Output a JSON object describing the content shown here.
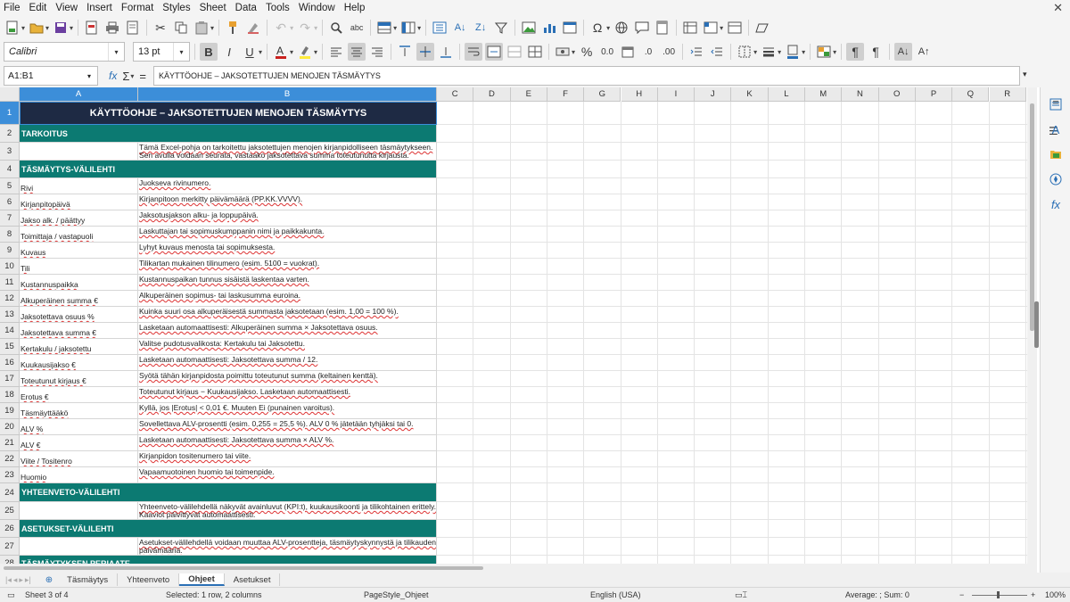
{
  "menu": {
    "items": [
      "File",
      "Edit",
      "View",
      "Insert",
      "Format",
      "Styles",
      "Sheet",
      "Data",
      "Tools",
      "Window",
      "Help"
    ],
    "close": "✕"
  },
  "format_bar": {
    "font_name": "Calibri",
    "font_size": "13 pt",
    "bold": "B",
    "italic": "I",
    "underline": "U"
  },
  "formula_bar": {
    "name_box": "A1:B1",
    "fx": "fx",
    "sigma": "Σ",
    "equals": "=",
    "content": "KÄYTTÖOHJE – JAKSOTETTUJEN MENOJEN TÄSMÄYTYS"
  },
  "columns": [
    "A",
    "B",
    "C",
    "D",
    "E",
    "F",
    "G",
    "H",
    "I",
    "J",
    "K",
    "L",
    "M",
    "N",
    "O",
    "P",
    "Q",
    "R"
  ],
  "rows": [
    {
      "num": "1",
      "type": "title",
      "text": "KÄYTTÖOHJE – JAKSOTETTUJEN MENOJEN TÄSMÄYTYS"
    },
    {
      "num": "2",
      "type": "section",
      "text": "TARKOITUS"
    },
    {
      "num": "3",
      "type": "row",
      "a": "",
      "b": "Tämä Excel-pohja on tarkoitettu jaksotettujen menojen kirjanpidolliseen täsmäytykseen. Sen avulla voidaan seurata, vastaako jaksotettava summa toteutunutta kirjausta."
    },
    {
      "num": "4",
      "type": "section",
      "text": "TÄSMÄYTYS-VÄLILEHTI"
    },
    {
      "num": "5",
      "type": "row",
      "a": "Rivi",
      "b": "Juokseva rivinumero."
    },
    {
      "num": "6",
      "type": "row",
      "a": "Kirjanpitopäivä",
      "b": "Kirjanpitoon merkitty päivämäärä (PP.KK.VVVV)."
    },
    {
      "num": "7",
      "type": "row",
      "a": "Jakso alk. / päättyy",
      "b": "Jaksotusjakson alku- ja loppupäivä."
    },
    {
      "num": "8",
      "type": "row",
      "a": "Toimittaja / vastapuoli",
      "b": "Laskuttajan tai sopimuskumppanin nimi ja paikkakunta."
    },
    {
      "num": "9",
      "type": "row",
      "a": "Kuvaus",
      "b": "Lyhyt kuvaus menosta tai sopimuksesta."
    },
    {
      "num": "10",
      "type": "row",
      "a": "Tili",
      "b": "Tilikartan mukainen tilinumero (esim. 5100 = vuokrat)."
    },
    {
      "num": "11",
      "type": "row",
      "a": "Kustannuspaikka",
      "b": "Kustannuspaikan tunnus sisäistä laskentaa varten."
    },
    {
      "num": "12",
      "type": "row",
      "a": "Alkuperäinen summa €",
      "b": "Alkuperäinen sopimus- tai laskusumma euroina."
    },
    {
      "num": "13",
      "type": "row",
      "a": "Jaksotettava osuus %",
      "b": "Kuinka suuri osa alkuperäisestä summasta jaksotetaan (esim. 1,00 = 100 %)."
    },
    {
      "num": "14",
      "type": "row",
      "a": "Jaksotettava summa €",
      "b": "Lasketaan automaattisesti: Alkuperäinen summa × Jaksotettava osuus."
    },
    {
      "num": "15",
      "type": "row",
      "a": "Kertakulu / jaksotettu",
      "b": "Valitse pudotusvalikosta: Kertakulu tai Jaksotettu."
    },
    {
      "num": "16",
      "type": "row",
      "a": "Kuukausijakso €",
      "b": "Lasketaan automaattisesti: Jaksotettava summa / 12."
    },
    {
      "num": "17",
      "type": "row",
      "a": "Toteutunut kirjaus €",
      "b": "Syötä tähän kirjanpidosta poimittu toteutunut summa (keltainen kenttä)."
    },
    {
      "num": "18",
      "type": "row",
      "a": "Erotus €",
      "b": "Toteutunut kirjaus − Kuukausijakso. Lasketaan automaattisesti."
    },
    {
      "num": "19",
      "type": "row",
      "a": "Täsmäyttääkö",
      "b": "Kyllä, jos |Erotus| < 0,01 €. Muuten Ei (punainen varoitus)."
    },
    {
      "num": "20",
      "type": "row",
      "a": "ALV %",
      "b": "Sovellettava ALV-prosentti (esim. 0,255 = 25,5 %). ALV 0 % jätetään tyhjäksi tai 0."
    },
    {
      "num": "21",
      "type": "row",
      "a": "ALV €",
      "b": "Lasketaan automaattisesti: Jaksotettava summa × ALV %."
    },
    {
      "num": "22",
      "type": "row",
      "a": "Viite / Tositenro",
      "b": "Kirjanpidon tositenumero tai viite."
    },
    {
      "num": "23",
      "type": "row",
      "a": "Huomio",
      "b": "Vapaamuotoinen huomio tai toimenpide."
    },
    {
      "num": "24",
      "type": "section",
      "text": "YHTEENVETO-VÄLILEHTI"
    },
    {
      "num": "25",
      "type": "row",
      "a": "",
      "b": "Yhteenveto-välilehdellä näkyvät avainluvut (KPI:t), kuukausikoonti ja tilikohtainen erittely. Kaaviot päivittyvät automaattisesti."
    },
    {
      "num": "26",
      "type": "section",
      "text": "ASETUKSET-VÄLILEHTI"
    },
    {
      "num": "27",
      "type": "row",
      "a": "",
      "b": "Asetukset-välilehdellä voidaan muuttaa ALV-prosentteja, täsmäytyskynnystä ja tilikauden päivämääriä."
    },
    {
      "num": "28",
      "type": "section",
      "text": "TÄSMÄYTYKSEN PERIAATE"
    }
  ],
  "sheet_tabs": [
    "Täsmäytys",
    "Yhteenveto",
    "Ohjeet",
    "Asetukset"
  ],
  "active_tab": "Ohjeet",
  "status": {
    "sheet": "Sheet 3 of 4",
    "selection": "Selected: 1 row, 2 columns",
    "page_style": "PageStyle_Ohjeet",
    "language": "English (USA)",
    "sum": "Average: ; Sum: 0",
    "zoom": "100%"
  },
  "colors": {
    "title_bg": "#1e2a44",
    "section_bg": "#0c7a72",
    "selection": "#3c8ed9"
  }
}
